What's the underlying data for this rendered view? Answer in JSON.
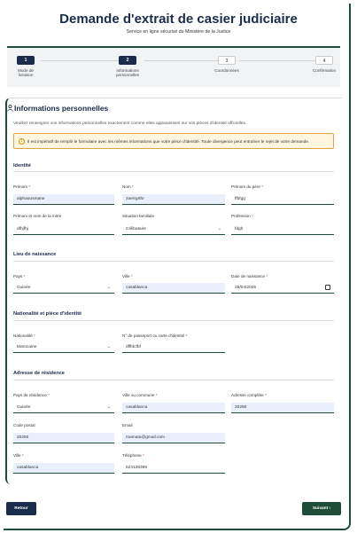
{
  "header": {
    "title": "Demande d'extrait de casier judiciaire",
    "subtitle": "Service en ligne sécurisé du Ministère de la Justice"
  },
  "stepper": [
    {
      "num": "1",
      "label_line1": "Mode de",
      "label_line2": "livraison"
    },
    {
      "num": "2",
      "label_line1": "Informations",
      "label_line2": "personnelles"
    },
    {
      "num": "3",
      "label_line1": "Coordonnées",
      "label_line2": ""
    },
    {
      "num": "4",
      "label_line1": "Confirmation",
      "label_line2": ""
    }
  ],
  "form": {
    "title": "Informations personnelles",
    "intro": "Veuillez renseigner vos informations personnelles exactement comme elles apparaissent sur vos pièces d'identité officielles.",
    "alert": "Il est impératif de remplir le formulaire avec les mêmes informations que votre pièce d'identité. Toute divergence peut entraîner le rejet de votre demande.",
    "required_mark": "*",
    "sections": {
      "identity": "Identité",
      "birth": "Lieu de naissance",
      "nationality": "Nationalité et pièce d'identité",
      "residence": "Adresse de résidence"
    },
    "fields": {
      "prenom": {
        "label": "Prénom",
        "value": "alphaousmane"
      },
      "nom": {
        "label": "Nom",
        "value": "zaerrgrthr"
      },
      "prenom_pere": {
        "label": "Prénom du père",
        "value": "ffbfgg"
      },
      "nom_mere": {
        "label": "Prénom et nom de la mère",
        "value": "dfhjfhj"
      },
      "situation": {
        "label": "Situation familiale",
        "value": "Célibataire"
      },
      "profession": {
        "label": "Profession",
        "value": "fdgh"
      },
      "pays": {
        "label": "Pays",
        "value": "Guinée"
      },
      "ville_naissance": {
        "label": "Ville",
        "value": "casablanca"
      },
      "date_naissance": {
        "label": "Date de naissance",
        "value": "25/04/2025"
      },
      "nationalite": {
        "label": "Nationalité",
        "value": "Marocaine"
      },
      "passeport": {
        "label": "N° de passeport ou carte d'identité",
        "value": "dfffdcfbf"
      },
      "pays_residence": {
        "label": "Pays de résidence",
        "value": "Guinée"
      },
      "ville_commune": {
        "label": "Ville ou commune",
        "value": "casablanca"
      },
      "adresse": {
        "label": "Adresse complète",
        "value": "20250"
      },
      "code_postal": {
        "label": "Code postal",
        "value": "20250"
      },
      "email": {
        "label": "Email",
        "value": "mamata@gmail.com"
      },
      "ville": {
        "label": "Ville",
        "value": "casablanca"
      },
      "telephone": {
        "label": "Téléphone",
        "value": "624138395"
      }
    }
  },
  "buttons": {
    "back": "Retour",
    "next": "Suivant",
    "next_icon": "›"
  }
}
